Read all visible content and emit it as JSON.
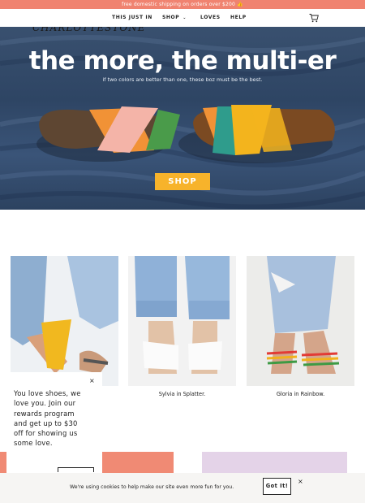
{
  "promo": {
    "text": "free domestic shipping on orders over $200 👍"
  },
  "nav": {
    "items": [
      {
        "label": "THIS JUST IN"
      },
      {
        "label": "SHOP"
      },
      {
        "label": "LOVES"
      },
      {
        "label": "HELP"
      }
    ]
  },
  "hero": {
    "logo": "CHARLOTTESTONE",
    "title": "the more, the multi-er",
    "subtitle": "if two colors are better than one, these boz must be the best.",
    "button": "SHOP"
  },
  "products": [
    {
      "caption": ""
    },
    {
      "caption": "Sylvia in Splatter."
    },
    {
      "caption": "Gloria in Rainbow."
    }
  ],
  "popup": {
    "close": "×",
    "text": "You love shoes, we love you. Join our rewards program and get up to $30 off for showing us some love."
  },
  "cookie": {
    "text": "We're using cookies to help make our site even more fun for you.",
    "button": "Got It!",
    "close": "×"
  },
  "colors": {
    "promo_bar": "#f08370",
    "shop_button": "#f7b32b",
    "coral_block": "#f08a74",
    "lilac_block": "#e4d3e8"
  }
}
